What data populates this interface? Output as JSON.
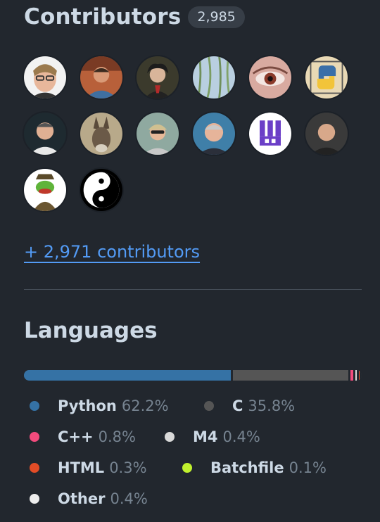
{
  "contributors": {
    "title": "Contributors",
    "count": "2,985",
    "more_link": "+ 2,971 contributors"
  },
  "languages": {
    "title": "Languages",
    "items": [
      {
        "name": "Python",
        "percent": "62.2%",
        "color": "#3572A5"
      },
      {
        "name": "C",
        "percent": "35.8%",
        "color": "#555555"
      },
      {
        "name": "C++",
        "percent": "0.8%",
        "color": "#f34b7d"
      },
      {
        "name": "M4",
        "percent": "0.4%",
        "color": "#d9d9d9"
      },
      {
        "name": "HTML",
        "percent": "0.3%",
        "color": "#e34c26"
      },
      {
        "name": "Batchfile",
        "percent": "0.1%",
        "color": "#C1F12E"
      },
      {
        "name": "Other",
        "percent": "0.4%",
        "color": "#ededed"
      }
    ]
  }
}
